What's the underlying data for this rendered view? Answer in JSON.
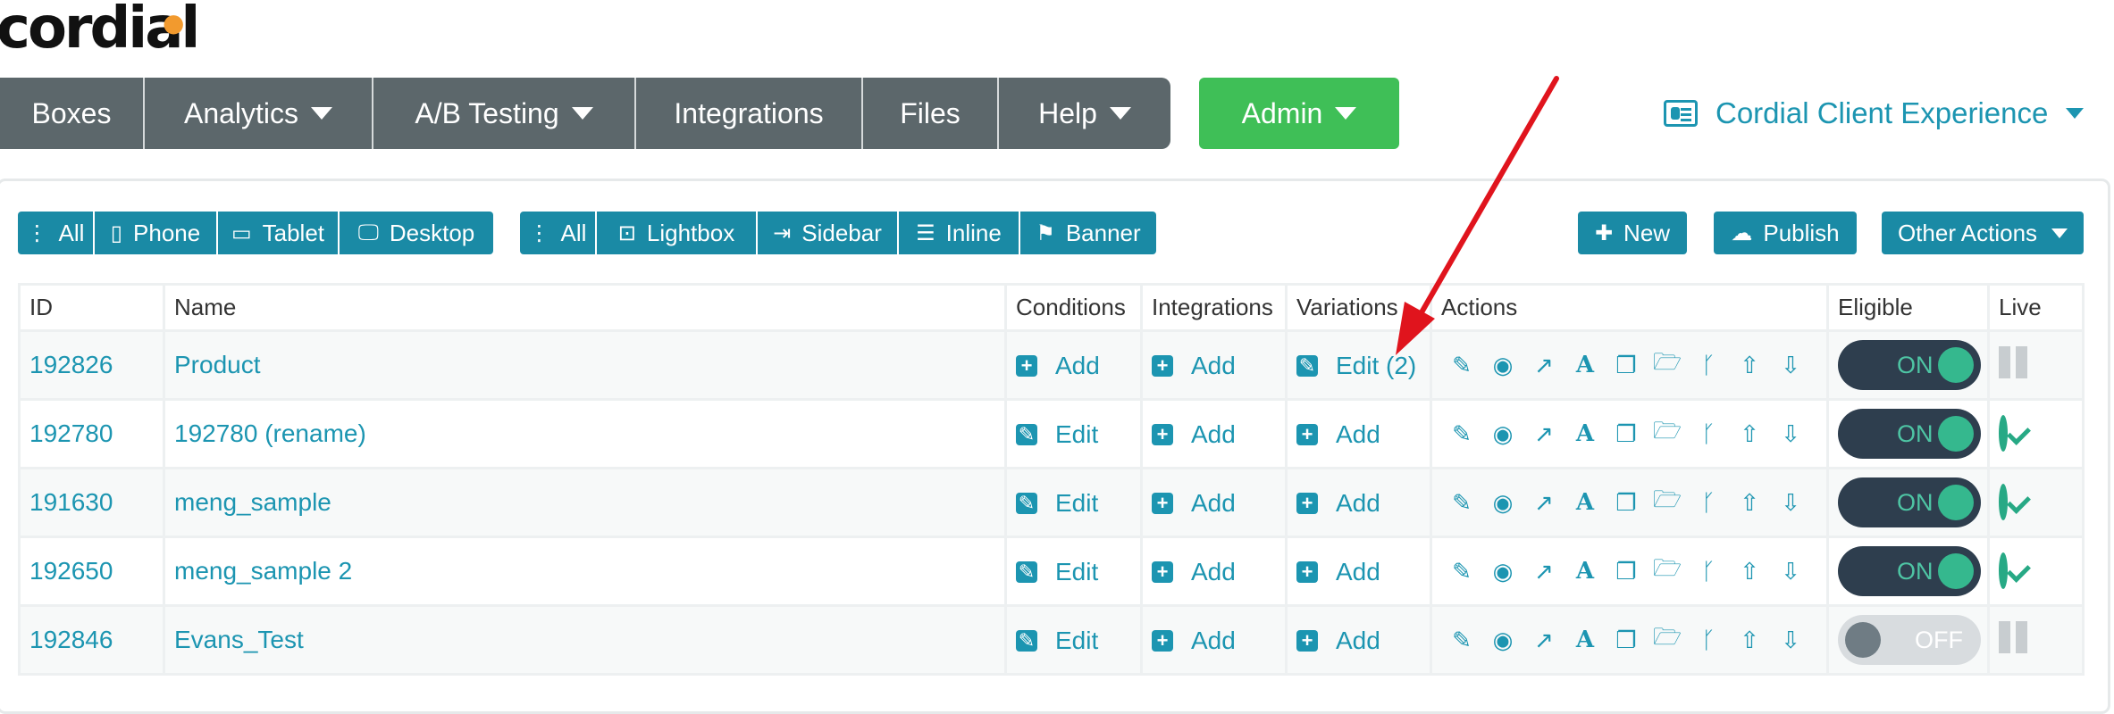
{
  "brand": {
    "name": "cordial"
  },
  "nav": {
    "items": [
      {
        "label": "Boxes",
        "dropdown": false
      },
      {
        "label": "Analytics",
        "dropdown": true
      },
      {
        "label": "A/B Testing",
        "dropdown": true
      },
      {
        "label": "Integrations",
        "dropdown": false
      },
      {
        "label": "Files",
        "dropdown": false
      },
      {
        "label": "Help",
        "dropdown": true
      }
    ],
    "admin_label": "Admin",
    "client_label": "Cordial Client Experience"
  },
  "filters": {
    "device": [
      "All",
      "Phone",
      "Tablet",
      "Desktop"
    ],
    "type": [
      "All",
      "Lightbox",
      "Sidebar",
      "Inline",
      "Banner"
    ]
  },
  "toolbar": {
    "new_label": "New",
    "publish_label": "Publish",
    "other_label": "Other Actions"
  },
  "table": {
    "headers": [
      "ID",
      "Name",
      "Conditions",
      "Integrations",
      "Variations",
      "Actions",
      "Eligible",
      "Live"
    ],
    "rows": [
      {
        "id": "192826",
        "name": "Product",
        "conditions": "Add",
        "integrations": "Add",
        "variations": "Edit (2)",
        "eligible": "ON",
        "live": "paused"
      },
      {
        "id": "192780",
        "name": "192780 (rename)",
        "conditions": "Edit",
        "integrations": "Add",
        "variations": "Add",
        "eligible": "ON",
        "live": "live"
      },
      {
        "id": "191630",
        "name": "meng_sample",
        "conditions": "Edit",
        "integrations": "Add",
        "variations": "Add",
        "eligible": "ON",
        "live": "live"
      },
      {
        "id": "192650",
        "name": "meng_sample 2",
        "conditions": "Edit",
        "integrations": "Add",
        "variations": "Add",
        "eligible": "ON",
        "live": "live"
      },
      {
        "id": "192846",
        "name": "Evans_Test",
        "conditions": "Edit",
        "integrations": "Add",
        "variations": "Add",
        "eligible": "OFF",
        "live": "paused"
      }
    ]
  },
  "colors": {
    "accent": "#1c95b1",
    "nav_bg": "#5c676b",
    "admin": "#3fbf57",
    "arrow": "#e0141d"
  }
}
